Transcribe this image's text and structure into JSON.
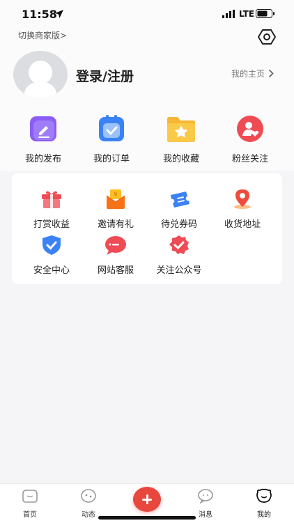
{
  "status_bar": {
    "time": "11:58",
    "network": "LTE"
  },
  "header": {
    "switch_label": "切换商家版>",
    "login_label": "登录/注册",
    "homepage_label": "我的主页"
  },
  "quick_actions": [
    {
      "label": "我的发布",
      "icon": "edit-icon"
    },
    {
      "label": "我的订单",
      "icon": "clipboard-check-icon"
    },
    {
      "label": "我的收藏",
      "icon": "star-folder-icon"
    },
    {
      "label": "粉丝关注",
      "icon": "fans-icon"
    }
  ],
  "services": [
    {
      "label": "打赏收益",
      "icon": "gift-icon"
    },
    {
      "label": "邀请有礼",
      "icon": "red-envelope-icon"
    },
    {
      "label": "待兑券码",
      "icon": "coupon-icon"
    },
    {
      "label": "收货地址",
      "icon": "location-pin-icon"
    },
    {
      "label": "安全中心",
      "icon": "shield-check-icon"
    },
    {
      "label": "网站客服",
      "icon": "chat-bubble-icon"
    },
    {
      "label": "关注公众号",
      "icon": "badge-check-icon"
    }
  ],
  "tabbar": [
    {
      "label": "首页",
      "icon": "home-face-icon"
    },
    {
      "label": "动态",
      "icon": "feed-face-icon"
    },
    {
      "label": "消息",
      "icon": "message-face-icon"
    },
    {
      "label": "我的",
      "icon": "profile-face-icon"
    }
  ],
  "colors": {
    "accent": "#e8473e",
    "card_bg": "#ffffff",
    "page_bg": "#f5f5f7"
  }
}
